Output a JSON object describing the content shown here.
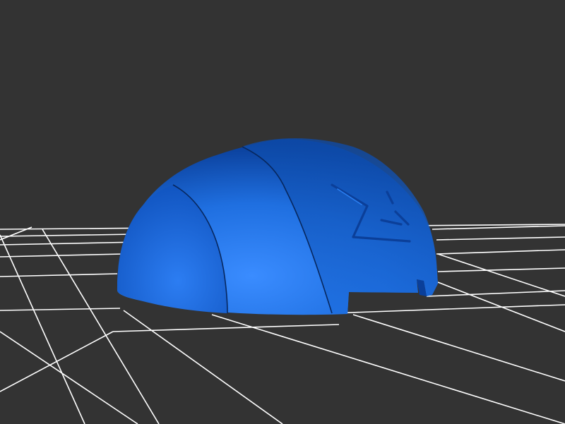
{
  "scene": {
    "background_color": "#333333",
    "grid_color": "#ffffff",
    "model_color": "#1f6fe0",
    "model_highlight_color": "#3a8cff",
    "model_shadow_color": "#0a3f9a",
    "model_object": "helmet-shell-3d-model",
    "emblem_object": "embossed-emblem"
  }
}
